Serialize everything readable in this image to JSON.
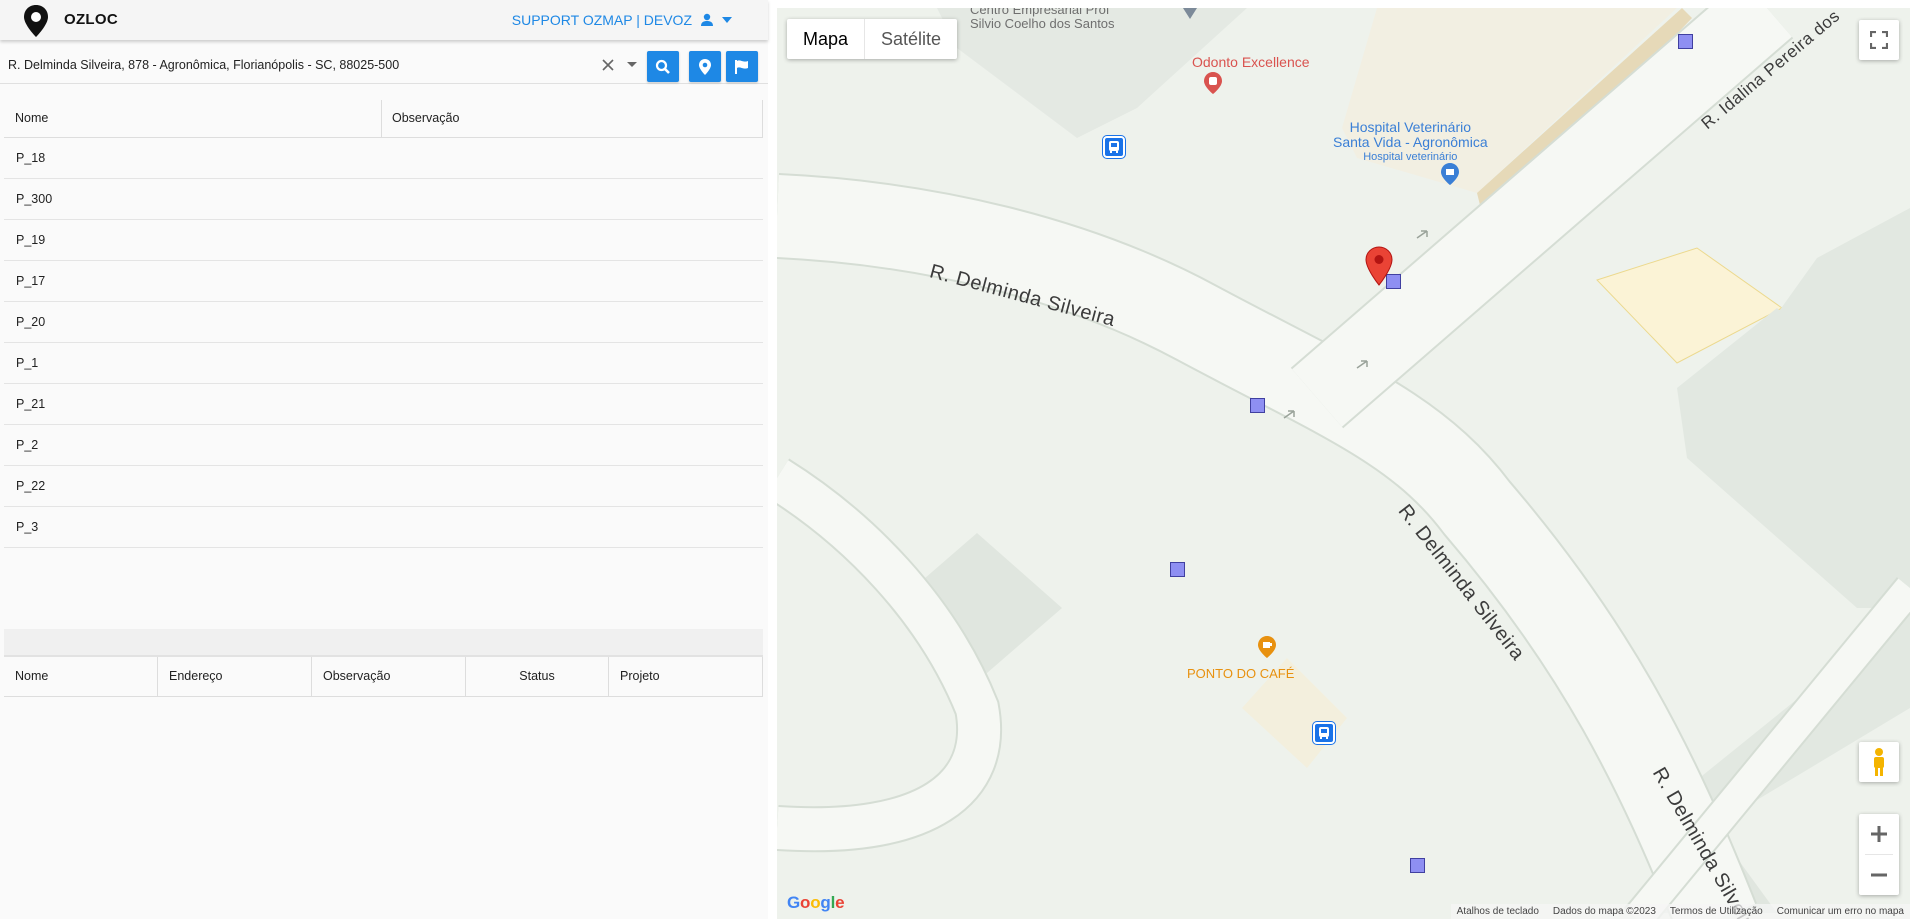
{
  "header": {
    "app_title": "OZLOC",
    "user_menu_label": "SUPPORT OZMAP | DEVOZ"
  },
  "search": {
    "value": "R. Delminda Silveira, 878 - Agronômica, Florianópolis - SC, 88025-500"
  },
  "points_table": {
    "columns": [
      "Nome",
      "Observação"
    ],
    "rows": [
      "P_18",
      "P_300",
      "P_19",
      "P_17",
      "P_20",
      "P_1",
      "P_21",
      "P_2",
      "P_22",
      "P_3"
    ]
  },
  "results_table": {
    "columns": [
      "Nome",
      "Endereço",
      "Observação",
      "Status",
      "Projeto"
    ]
  },
  "map": {
    "type_buttons": [
      "Mapa",
      "Satélite"
    ],
    "active_type": "Mapa",
    "places": {
      "centro_line1": "Centro Empresarial Prof",
      "centro_line2": "Silvio Coelho dos Santos",
      "odonto": "Odonto Excellence",
      "hospital_line1": "Hospital Veterinário",
      "hospital_line2": "Santa Vida - Agronômica",
      "hospital_sub": "Hospital veterinário",
      "cafe": "PONTO DO CAFÉ"
    },
    "roads": {
      "delminda_1": "R. Delminda Silveira",
      "delminda_2": "R. Delminda Silveira",
      "delminda_3": "R. Delminda Silveira",
      "idalina": "R. Idalina Pereira dos"
    },
    "attribution": {
      "shortcuts": "Atalhos de teclado",
      "data": "Dados do mapa ©2023",
      "terms": "Termos de Utilização",
      "report": "Comunicar um erro no mapa"
    },
    "logo": "Google",
    "colors": {
      "accent": "#1e88e5",
      "marker_square": "#8e8ff2",
      "pin": "#ea4335",
      "bus_stop": "#1a73e8",
      "odonto": "#d9534f",
      "cafe": "#e8910f",
      "hospital": "#3a7fd6"
    }
  }
}
